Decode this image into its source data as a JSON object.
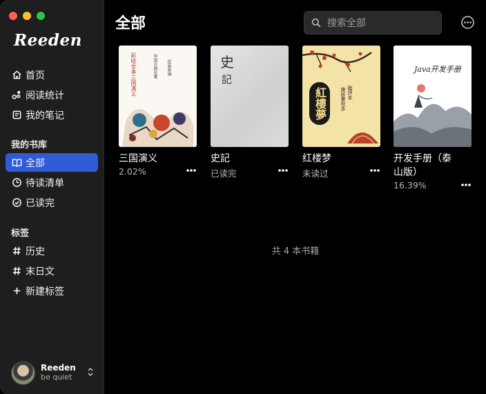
{
  "app": {
    "logo": "Reeden"
  },
  "sidebar": {
    "nav": [
      {
        "label": "首页",
        "icon": "home-icon"
      },
      {
        "label": "阅读统计",
        "icon": "stats-icon"
      },
      {
        "label": "我的笔记",
        "icon": "notes-icon"
      }
    ],
    "library_title": "我的书库",
    "library": [
      {
        "label": "全部",
        "icon": "book-icon",
        "active": true
      },
      {
        "label": "待读清单",
        "icon": "clock-icon"
      },
      {
        "label": "已读完",
        "icon": "check-circle-icon"
      }
    ],
    "tags_title": "标签",
    "tags": [
      {
        "label": "历史",
        "icon": "hashtag-icon"
      },
      {
        "label": "末日文",
        "icon": "hashtag-icon"
      },
      {
        "label": "新建标签",
        "icon": "plus-icon"
      }
    ],
    "user": {
      "name": "Reeden",
      "status": "be quiet"
    }
  },
  "main": {
    "title": "全部",
    "search_placeholder": "搜索全部",
    "books": [
      {
        "title": "三国演义",
        "meta": "2.02%",
        "cover": {
          "lines": [
            "彩绘全本三国演义",
            "中国古典名著",
            "绘画新编"
          ]
        }
      },
      {
        "title": "史記",
        "meta": "已读完",
        "cover": {
          "lines": [
            "史",
            "記"
          ]
        }
      },
      {
        "title": "红楼梦",
        "meta": "未读过",
        "cover": {
          "lines": [
            "紅樓夢",
            "脂評本",
            "庚辰彙校本"
          ]
        }
      },
      {
        "title": "开发手册（泰山版）",
        "meta": "16.39%",
        "cover": {
          "lines": [
            "Java开发手册"
          ]
        }
      }
    ],
    "count_text": "共 4 本书籍"
  },
  "colors": {
    "accent": "#2f5bd6",
    "sidebar_bg": "#1e1e1f",
    "main_bg": "#000000"
  }
}
